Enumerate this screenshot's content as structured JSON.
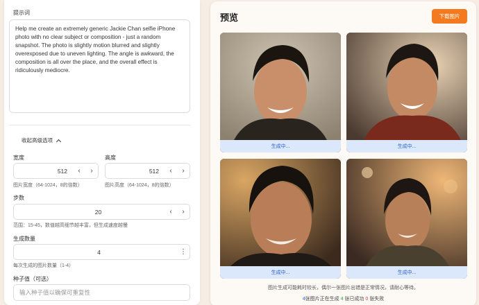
{
  "left": {
    "prompt_label": "提示词",
    "prompt_text": "Help me create an extremely generic Jackie Chan selfie iPhone photo with no clear subject or composition - just a random snapshot. The photo is slightly motion blurred and slightly overexposed due to uneven lighting. The angle is awkward, the composition is all over the place, and the overall effect is ridiculously mediocre.",
    "advanced_toggle": "收起高级选项",
    "width_label": "宽度",
    "width_value": "512",
    "width_hint": "图片宽度（64-1024，8的倍数）",
    "height_label": "高度",
    "height_value": "512",
    "height_hint": "图片高度（64-1024，8的倍数）",
    "steps_label": "步数",
    "steps_value": "20",
    "steps_hint": "范围：15-45，数值越高细节越丰富，但生成速度越慢",
    "count_label": "生成数量",
    "count_value": "4",
    "count_hint": "每次生成的图片数量（1-4）",
    "seed_label": "种子值（可选）",
    "seed_placeholder": "输入种子值以确保可重复性"
  },
  "right": {
    "title": "预览",
    "download_label": "下载图片",
    "images": [
      {
        "status": "生成中..."
      },
      {
        "status": "生成中..."
      },
      {
        "status": "生成中..."
      },
      {
        "status": "生成中..."
      }
    ],
    "note": "图片生成可能耗时较长，偶尔一张图片出错是正常情况，请耐心等待。",
    "status": {
      "generating_count": "4",
      "generating_text": "张图片正在生成",
      "success_count": "4",
      "success_text": "张已成功",
      "fail_count": "0",
      "fail_text": "张失败"
    }
  },
  "colors": {
    "accent": "#f47a1f",
    "generating_bar": "#dbe7fb",
    "generating_text": "#2b5fd9",
    "success": "#27a347",
    "fail": "#e0342b"
  }
}
